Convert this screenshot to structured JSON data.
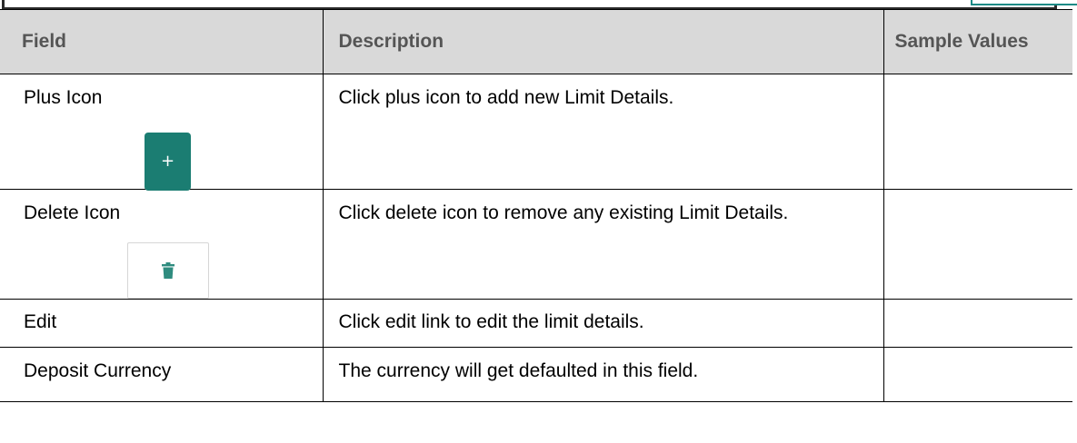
{
  "table": {
    "headers": {
      "field": "Field",
      "description": "Description",
      "sample_values": "Sample Values"
    },
    "rows": [
      {
        "field": "Plus Icon",
        "description": "Click plus icon to add new Limit Details.",
        "sample": "",
        "icon": "plus-icon",
        "icon_glyph": "+"
      },
      {
        "field": "Delete Icon",
        "description": "Click delete icon to remove any existing Limit Details.",
        "sample": "",
        "icon": "trash-icon"
      },
      {
        "field": "Edit",
        "description": "Click edit link to edit the limit details.",
        "sample": ""
      },
      {
        "field": "Deposit Currency",
        "description": "The currency will get defaulted in this field.",
        "sample": ""
      }
    ]
  },
  "colors": {
    "header_bg": "#d9d9d9",
    "header_text": "#555555",
    "plus_button": "#1b7d72",
    "trash_icon": "#2f8c7f"
  }
}
